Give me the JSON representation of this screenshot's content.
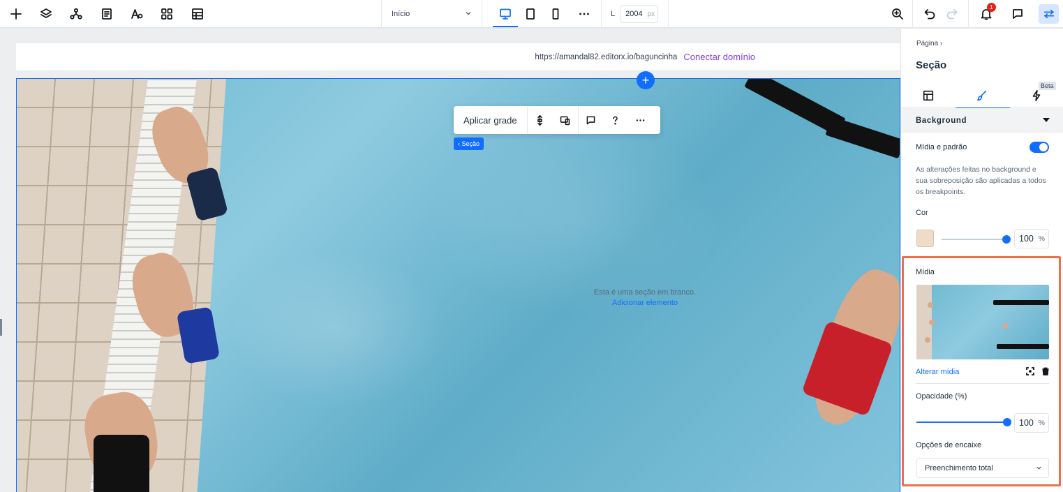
{
  "toolbar": {
    "page_select": "Início",
    "width_label": "L",
    "width_value": "2004",
    "width_unit": "px",
    "notification_count": "1"
  },
  "site": {
    "url": "https://amandal82.editorx.io/baguncinha",
    "connect_domain": "Conectar domínio"
  },
  "canvas": {
    "floating_toolbar_apply": "Aplicar grade",
    "section_tag": "‹ Seção",
    "empty_text": "Esta é uma seção em branco.",
    "add_element": "Adicionar elemento",
    "add_icon": "+"
  },
  "panel": {
    "breadcrumb": "Página ›",
    "title": "Seção",
    "beta_badge": "Beta",
    "accordion": "Background",
    "media_pattern_label": "Mídia e padrão",
    "media_pattern_on": true,
    "note": "As alterações feitas no background e sua sobreposição são aplicadas a todos os breakpoints.",
    "color_label": "Cor",
    "color_swatch": "#efdcc8",
    "color_opacity": "100",
    "percent": "%",
    "media_label": "Mídia",
    "change_media": "Alterar mídia",
    "opacity_label": "Opacidade (%)",
    "media_opacity": "100",
    "fit_label": "Opções de encaixe",
    "fit_value": "Preenchimento total"
  },
  "colors": {
    "accent": "#116dff",
    "highlight": "#f06e4e",
    "connect": "#7d3ee0"
  }
}
